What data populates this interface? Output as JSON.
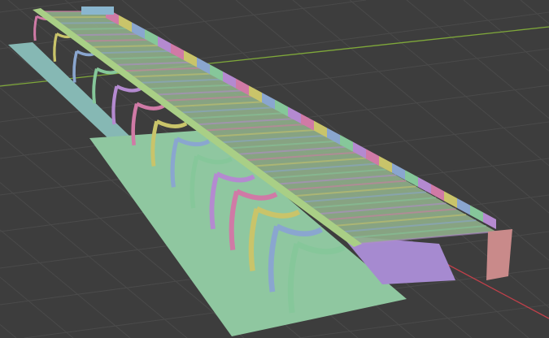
{
  "viewport": {
    "background": "#3d3d3d",
    "grid_color": "#4a4a4a",
    "x_axis_color": "#c0404a",
    "y_axis_color": "#7fa83a"
  },
  "scene": {
    "object": "bridge",
    "arch_colors": [
      "#d07aa6",
      "#c9c46a",
      "#8aa6cf",
      "#86c79a",
      "#b48ad0"
    ],
    "deck_color": "#a9cf86",
    "ground_green": "#8fc7a0",
    "ground_teal": "#86b8b4",
    "ground_purple": "#a68ad0",
    "arch_count": 14
  }
}
